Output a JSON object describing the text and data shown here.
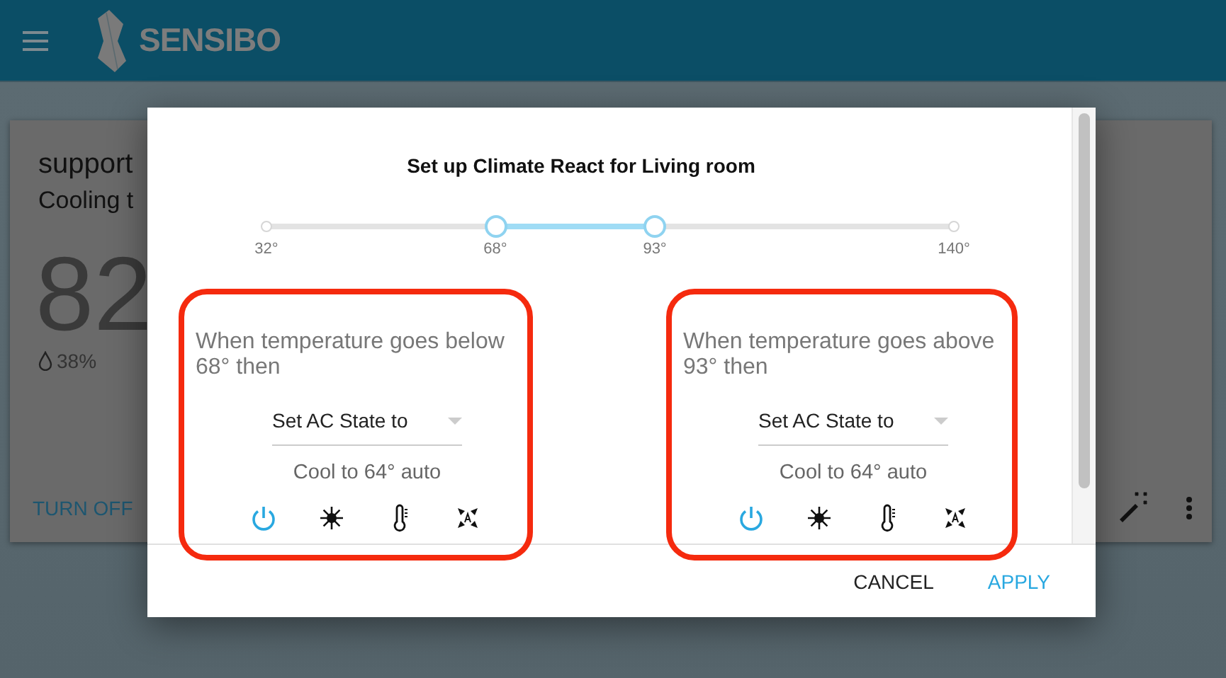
{
  "app_bar": {
    "brand": "SENSIBO"
  },
  "device_card": {
    "name": "support",
    "status": "Cooling t",
    "temperature": "82",
    "humidity": "38%",
    "action": "TURN OFF"
  },
  "dialog": {
    "title": "Set up Climate React for Living room",
    "slider": {
      "min_label": "32°",
      "max_label": "140°",
      "thumbs": [
        {
          "label": "68°",
          "level": 0.333
        },
        {
          "label": "93°",
          "level": 0.565
        }
      ]
    },
    "rules": [
      {
        "condition": "When temperature goes below 68° then",
        "action": "Set AC State to",
        "state": "Cool to 64° auto",
        "highlighted": true,
        "icons": [
          {
            "kind": "power",
            "active": true
          },
          {
            "kind": "mode",
            "active": false
          },
          {
            "kind": "temperature",
            "active": false
          },
          {
            "kind": "fan",
            "active": false
          }
        ]
      },
      {
        "condition": "When temperature goes above 93° then",
        "action": "Set AC State to",
        "state": "Cool to 64° auto",
        "highlighted": true,
        "icons": [
          {
            "kind": "power",
            "active": true
          },
          {
            "kind": "mode",
            "active": false
          },
          {
            "kind": "temperature",
            "active": false
          },
          {
            "kind": "fan",
            "active": false
          }
        ]
      }
    ],
    "buttons": [
      {
        "label": "CANCEL",
        "kind": "secondary"
      },
      {
        "label": "APPLY",
        "kind": "primary"
      }
    ]
  }
}
